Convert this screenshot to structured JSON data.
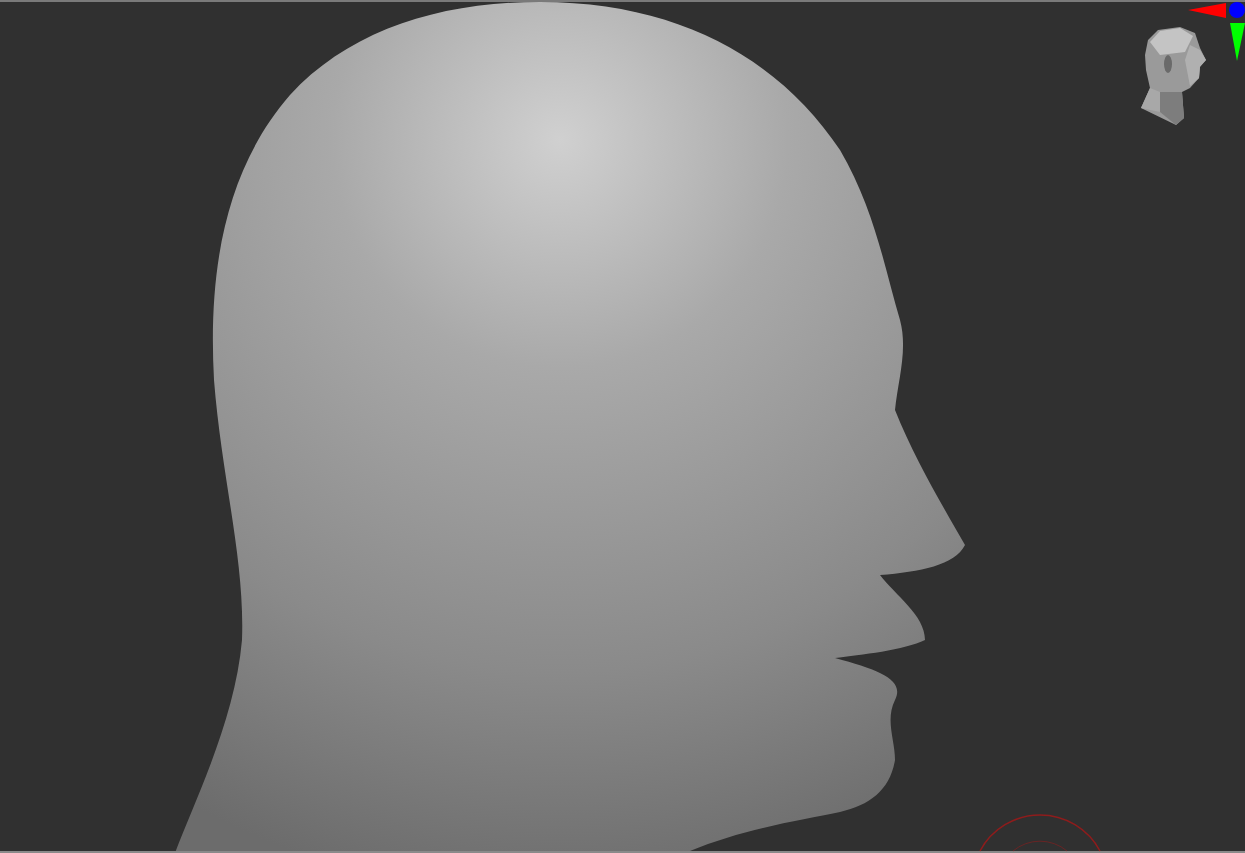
{
  "navigation_gizmo": {
    "axes": [
      {
        "kind": "x",
        "color": "#ff0000"
      },
      {
        "kind": "z",
        "color": "#0000ff"
      },
      {
        "kind": "y",
        "color": "#00ff00"
      }
    ]
  }
}
